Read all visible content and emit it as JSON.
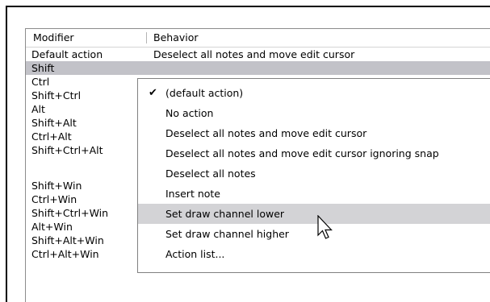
{
  "columns": {
    "modifier": "Modifier",
    "behavior": "Behavior"
  },
  "rows": [
    {
      "modifier": "Default action",
      "behavior": "Deselect all notes and move edit cursor"
    },
    {
      "modifier": "Shift",
      "behavior": ""
    },
    {
      "modifier": "Ctrl",
      "behavior": ""
    },
    {
      "modifier": "Shift+Ctrl",
      "behavior": ""
    },
    {
      "modifier": "Alt",
      "behavior": ""
    },
    {
      "modifier": "Shift+Alt",
      "behavior": ""
    },
    {
      "modifier": "Ctrl+Alt",
      "behavior": ""
    },
    {
      "modifier": "Shift+Ctrl+Alt",
      "behavior": ""
    },
    {
      "modifier": "",
      "behavior": ""
    },
    {
      "modifier": "Shift+Win",
      "behavior": ""
    },
    {
      "modifier": "Ctrl+Win",
      "behavior": ""
    },
    {
      "modifier": "Shift+Ctrl+Win",
      "behavior": ""
    },
    {
      "modifier": "Alt+Win",
      "behavior": ""
    },
    {
      "modifier": "Shift+Alt+Win",
      "behavior": ""
    },
    {
      "modifier": "Ctrl+Alt+Win",
      "behavior": ""
    }
  ],
  "dropdown": {
    "checkmark": "✔",
    "items": [
      "(default action)",
      "No action",
      "Deselect all notes and move edit cursor",
      "Deselect all notes and move edit cursor ignoring snap",
      "Deselect all notes",
      "Insert note",
      "Set draw channel lower",
      "Set draw channel higher",
      "Action list..."
    ]
  },
  "colors": {
    "selected_row": "#c2c2c8",
    "hover_item": "#d3d3d6",
    "window_border": "#000000"
  }
}
